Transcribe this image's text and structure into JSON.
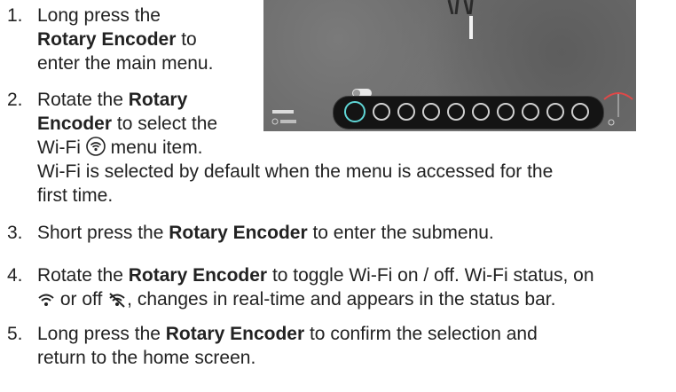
{
  "steps": [
    {
      "num": "1.",
      "lines": [
        [
          "Long press the"
        ],
        [
          "Rotary Encoder",
          " to"
        ],
        [
          "enter the main menu."
        ]
      ]
    },
    {
      "num": "2.",
      "a": "Rotate the ",
      "b": "Rotary",
      "c": "Encoder",
      "d": " to select the",
      "e": "Wi-Fi ",
      "f": " menu item.",
      "g": "Wi-Fi is selected by default when the menu is accessed for the",
      "h": "first time."
    },
    {
      "num": "3.",
      "a": "Short press the ",
      "b": "Rotary Encoder",
      "c": " to enter the submenu."
    },
    {
      "num": "4.",
      "a": "Rotate the ",
      "b": "Rotary Encoder",
      "c": " to toggle Wi-Fi on / off. Wi-Fi status, on",
      "d": " or off ",
      "e": ", changes in real-time and appears in the status bar."
    },
    {
      "num": "5.",
      "a": "Long press the ",
      "b": "Rotary Encoder",
      "c": " to confirm the selection and",
      "d": "return to the home screen."
    }
  ],
  "screen": {
    "description_icons": [
      "wifi-icon",
      "compass-icon",
      "microphone-icon",
      "phone-icon",
      "camera-icon",
      "image-icon",
      "crosshair-icon",
      "target-icon",
      "record-icon",
      "settings-icon"
    ],
    "selected_icon": "wifi-icon",
    "selection_color": "#5fd6d6"
  }
}
